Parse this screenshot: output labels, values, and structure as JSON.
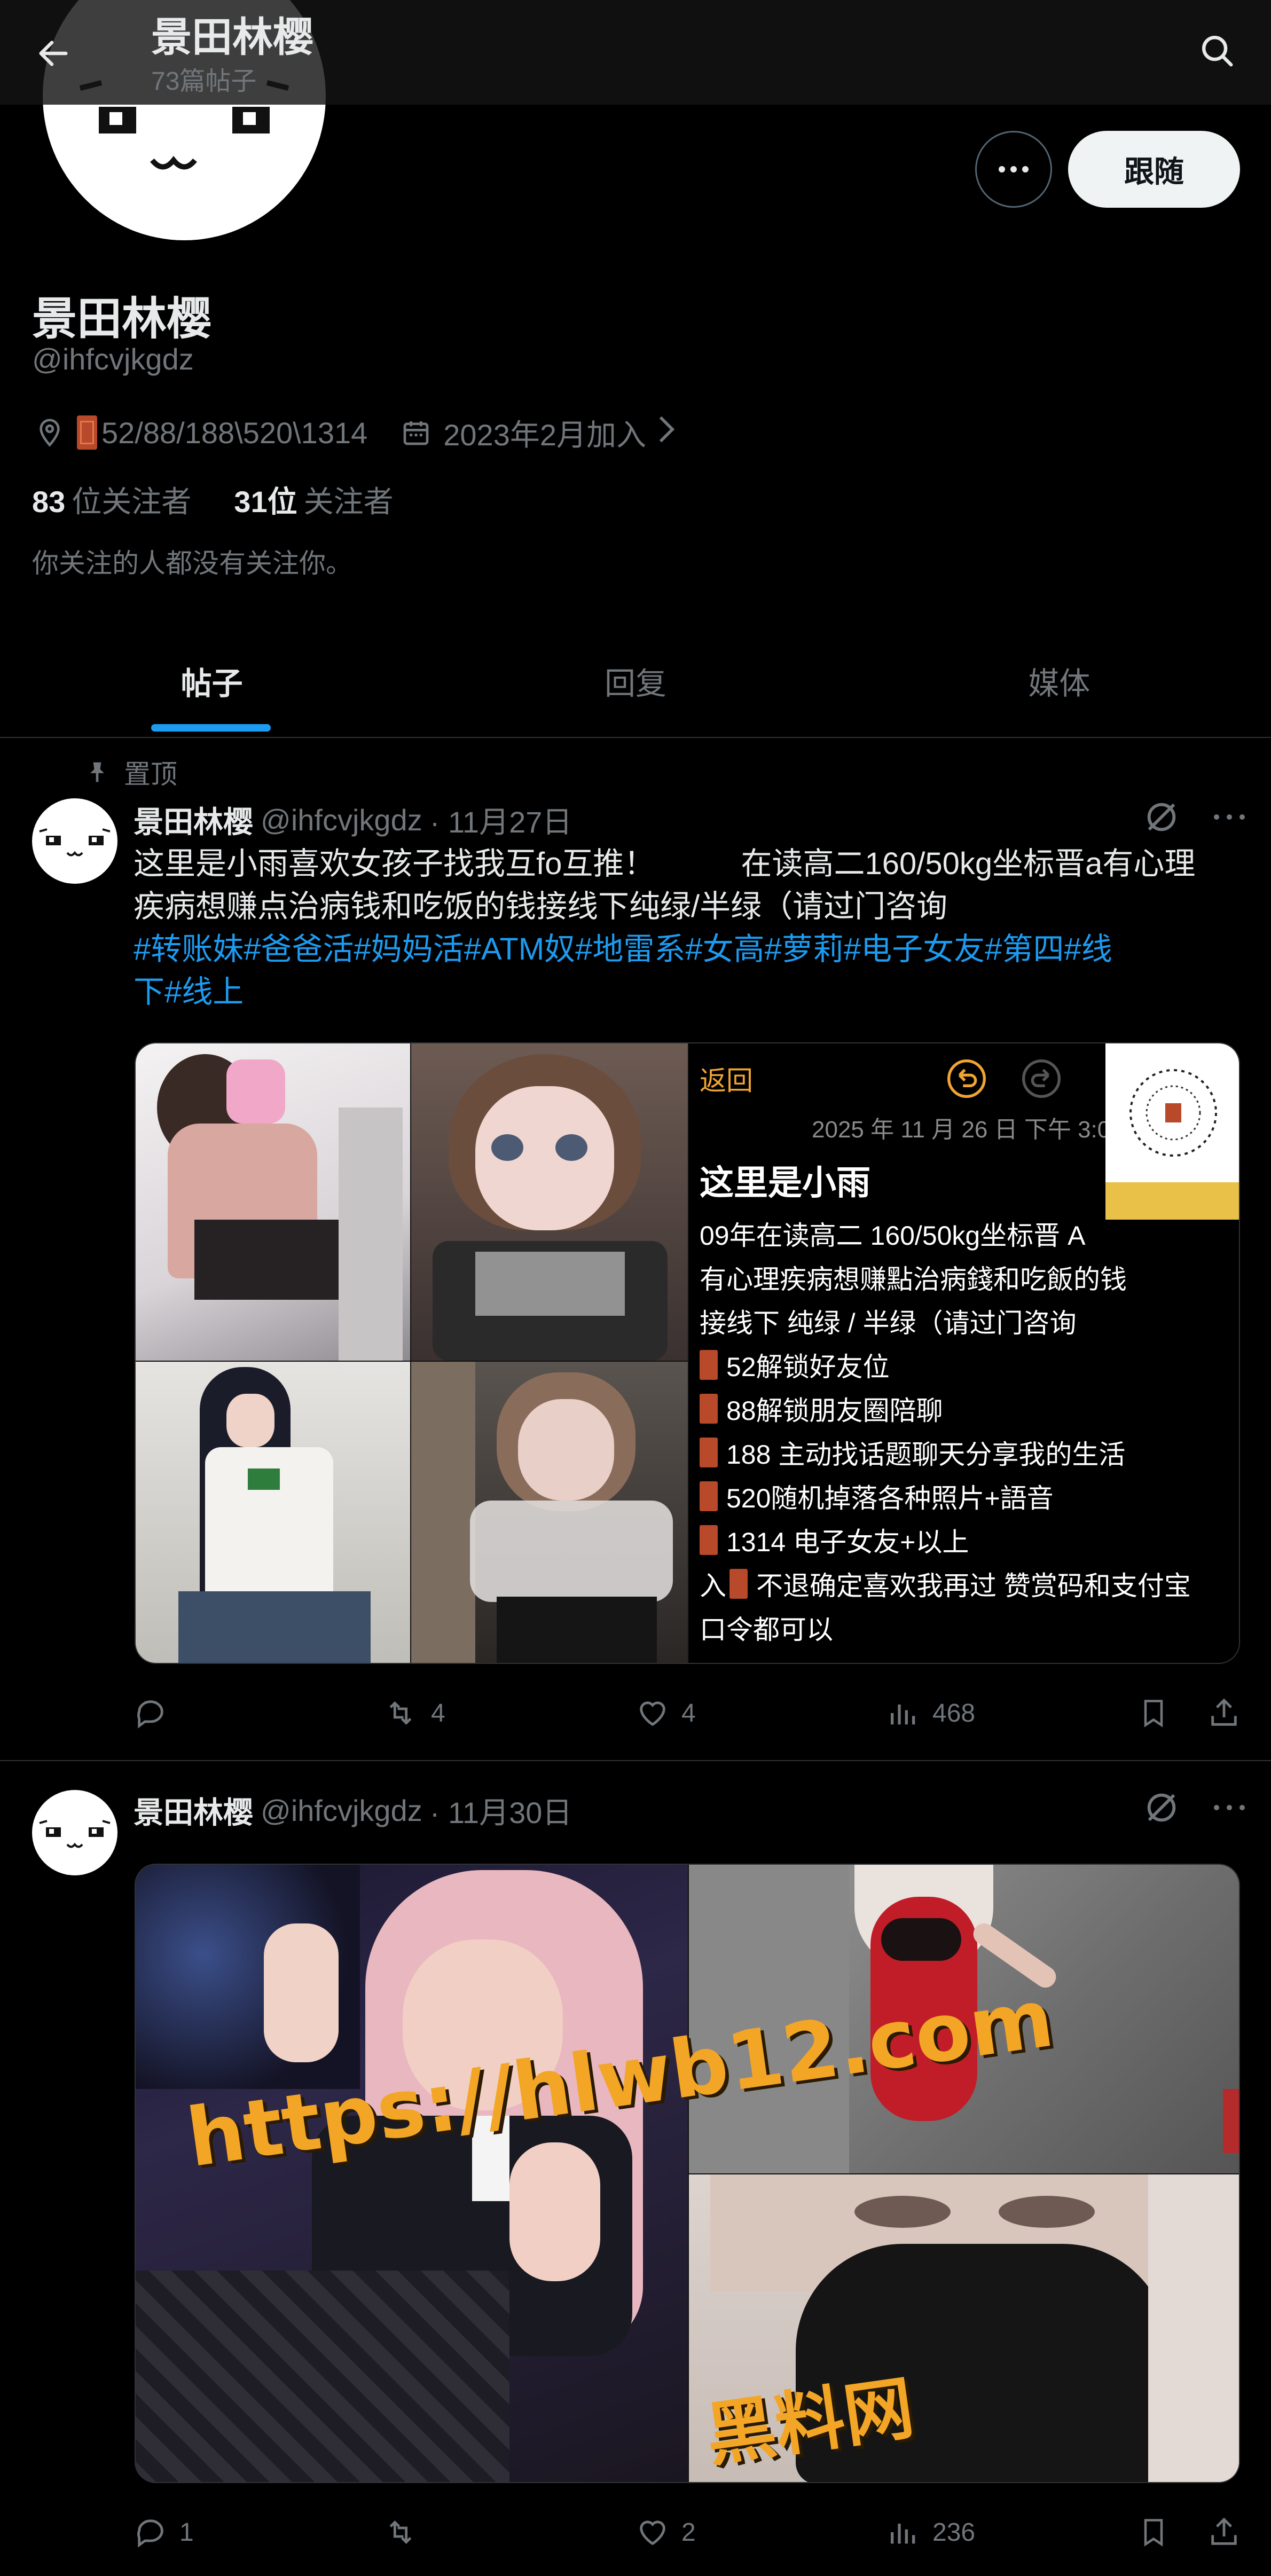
{
  "header": {
    "title": "景田林樱",
    "post_count": "73篇帖子"
  },
  "profile": {
    "name": "景田林樱",
    "handle": "@ihfcvjkgdz",
    "location": "52/88/188\\520\\1314",
    "joined": "2023年2月加入",
    "following_count": "83",
    "following_label": "位关注者",
    "followers_count": "31位",
    "followers_label": "关注者",
    "mutual_note": "你关注的人都没有关注你。",
    "follow_label": "跟随"
  },
  "tabs": [
    {
      "label": "帖子",
      "active": true
    },
    {
      "label": "回复",
      "active": false
    },
    {
      "label": "媒体",
      "active": false
    }
  ],
  "posts": [
    {
      "pinned_label": "置顶",
      "author": "景田林樱",
      "handle": "@ihfcvjkgdz",
      "date": "· 11月27日",
      "text_line1": "这里是小雨喜欢女孩子找我互fo互推！          在读高二160/50kg坐标晋a有心理",
      "text_line2": "疾病想赚点治病钱和吃饭的钱接线下纯绿/半绿（请过门咨询",
      "tags_line1": "#转账妹#爸爸活#妈妈活#ATM奴#地雷系#女高#萝莉#电子女友#第四#线",
      "tags_line2": "下#线上",
      "note_screenshot": {
        "back": "返回",
        "date": "2025 年 11 月 26 日 下午 3:0",
        "title": "这里是小雨",
        "lines": [
          "09年在读高二 160/50kg坐标晋 A",
          "有心理疾病想赚點治病錢和吃飯的钱",
          " 接线下 纯绿 / 半绿（请过门咨询",
          "52解锁好友位",
          "88解锁朋友圈陪聊",
          "188 主动找话题聊天分享我的生活",
          "520随机掉落各种照片+語音",
          "1314 电子女友+以上",
          "不退确定喜欢我再过  赞赏码和支付宝",
          "口令都可以"
        ]
      },
      "replies": "",
      "reposts": "4",
      "likes": "4",
      "views": "468"
    },
    {
      "author": "景田林樱",
      "handle": "@ihfcvjkgdz",
      "date": "· 11月30日",
      "watermark_url": "https://hlwb12.com",
      "watermark_name": "黑料网",
      "replies": "1",
      "reposts": "",
      "likes": "2",
      "views": "236"
    }
  ],
  "colors": {
    "accent": "#1d9bf0",
    "muted": "#71767b",
    "watermark": "#f3a526"
  }
}
